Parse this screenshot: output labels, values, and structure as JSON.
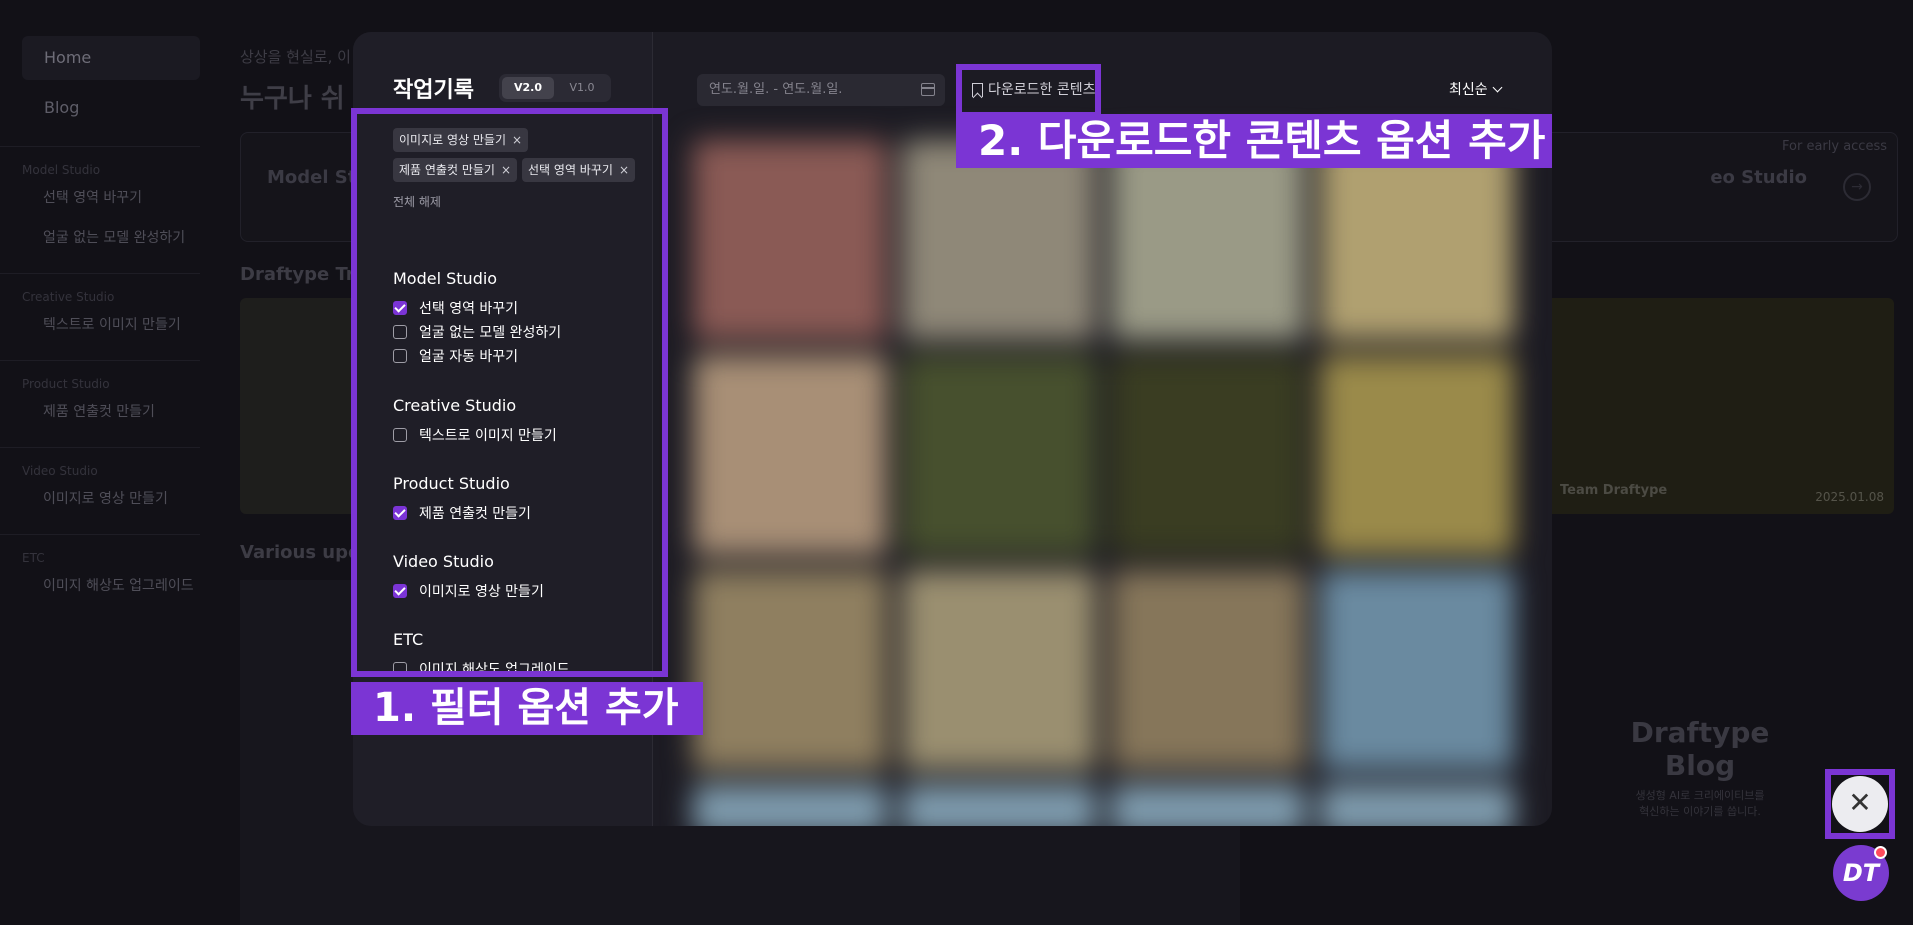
{
  "sidebar": {
    "home": "Home",
    "blog": "Blog",
    "groups": [
      {
        "title": "Model Studio",
        "links": [
          "선택 영역 바꾸기",
          "얼굴 없는 모델 완성하기"
        ]
      },
      {
        "title": "Creative Studio",
        "links": [
          "텍스트로 이미지 만들기"
        ]
      },
      {
        "title": "Product Studio",
        "links": [
          "제품 연출컷 만들기"
        ]
      },
      {
        "title": "Video Studio",
        "links": [
          "이미지로 영상 만들기"
        ]
      },
      {
        "title": "ETC",
        "links": [
          "이미지 해상도 업그레이드"
        ]
      }
    ]
  },
  "background": {
    "hero_sub": "상상을 현실로, 이",
    "hero_title": "누구나 쉬",
    "card_left": "Model Stu",
    "card_right": "eo Studio",
    "early_access": "For early access",
    "trend_title": "Draftype Tre",
    "various_title": "Various upd",
    "team_label": "Team Draftype",
    "date": "2025.01.08",
    "blog_title": "Draftype Blog",
    "blog_sub_1": "생성형 AI로 크리에이티브를",
    "blog_sub_2": "혁신하는 이야기를 씁니다."
  },
  "modal": {
    "title": "작업기록",
    "version_active": "V2.0",
    "version_inactive": "V1.0",
    "chips": [
      "이미지로 영상 만들기",
      "제품 연출컷 만들기",
      "선택 영역 바꾸기"
    ],
    "chip_close_icon": "×",
    "clear_all": "전체 해제",
    "filter_groups": [
      {
        "title": "Model Studio",
        "items": [
          {
            "label": "선택 영역 바꾸기",
            "checked": true
          },
          {
            "label": "얼굴 없는 모델 완성하기",
            "checked": false
          },
          {
            "label": "얼굴 자동 바꾸기",
            "checked": false
          }
        ]
      },
      {
        "title": "Creative Studio",
        "items": [
          {
            "label": "텍스트로 이미지 만들기",
            "checked": false
          }
        ]
      },
      {
        "title": "Product Studio",
        "items": [
          {
            "label": "제품 연출컷 만들기",
            "checked": true
          }
        ]
      },
      {
        "title": "Video Studio",
        "items": [
          {
            "label": "이미지로 영상 만들기",
            "checked": true
          }
        ]
      },
      {
        "title": "ETC",
        "items": [
          {
            "label": "이미지 해상도 업그레이드",
            "checked": false
          }
        ]
      }
    ],
    "date_placeholder": "연도.월.일. - 연도.월.일.",
    "downloaded_toggle": "다운로드한 콘텐츠",
    "sort_label": "최신순",
    "grid_colors": [
      [
        "#8a5a55",
        "#a88f76",
        "#8f7f60"
      ],
      [
        "#8f8878",
        "#47502e",
        "#9a8f70"
      ],
      [
        "#9a9a86",
        "#3a3d22",
        "#86765a"
      ],
      [
        "#b0a070",
        "#9a8a4a",
        "#6a8aa0"
      ]
    ]
  },
  "annotations": {
    "label_1": "1. 필터 옵션 추가",
    "label_2": "2. 다운로드한 콘텐츠 옵션 추가",
    "accent": "#7b35d4"
  },
  "fab": {
    "close_icon": "✕",
    "dt_label": "DT"
  }
}
